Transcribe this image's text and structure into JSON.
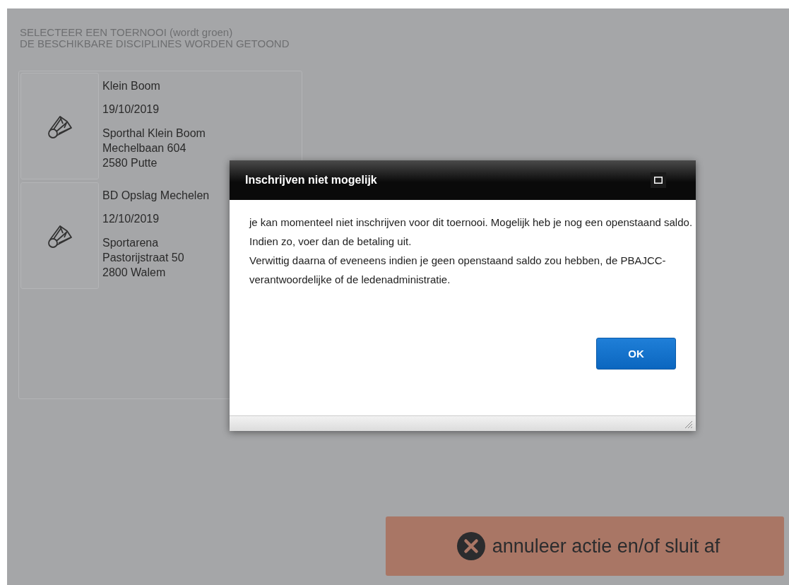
{
  "instructions": [
    "SELECTEER EEN TOERNOOI (wordt groen)",
    "DE BESCHIKBARE DISCIPLINES WORDEN GETOOND"
  ],
  "tournaments": [
    {
      "name": "Klein Boom",
      "date": "19/10/2019",
      "address": [
        "Sporthal Klein Boom",
        "Mechelbaan 604",
        "2580 Putte"
      ],
      "selected": false
    },
    {
      "name": "BD Opslag Mechelen",
      "date": "12/10/2019",
      "address": [
        "Sportarena",
        "Pastorijstraat 50",
        "2800 Walem"
      ],
      "selected": false
    }
  ],
  "dialog": {
    "title": "Inschrijven niet mogelijk",
    "paragraphs": [
      "je kan momenteel niet inschrijven voor dit toernooi. Mogelijk heb je nog een openstaand saldo.",
      "Indien zo, voer dan de betaling uit.",
      "Verwittig daarna of eveneens indien je geen openstaand saldo zou hebben, de PBAJCC-verantwoordelijke of de ledenadministratie."
    ],
    "ok_button": "OK"
  },
  "cancel_button": "annuleer actie en/of sluit af"
}
